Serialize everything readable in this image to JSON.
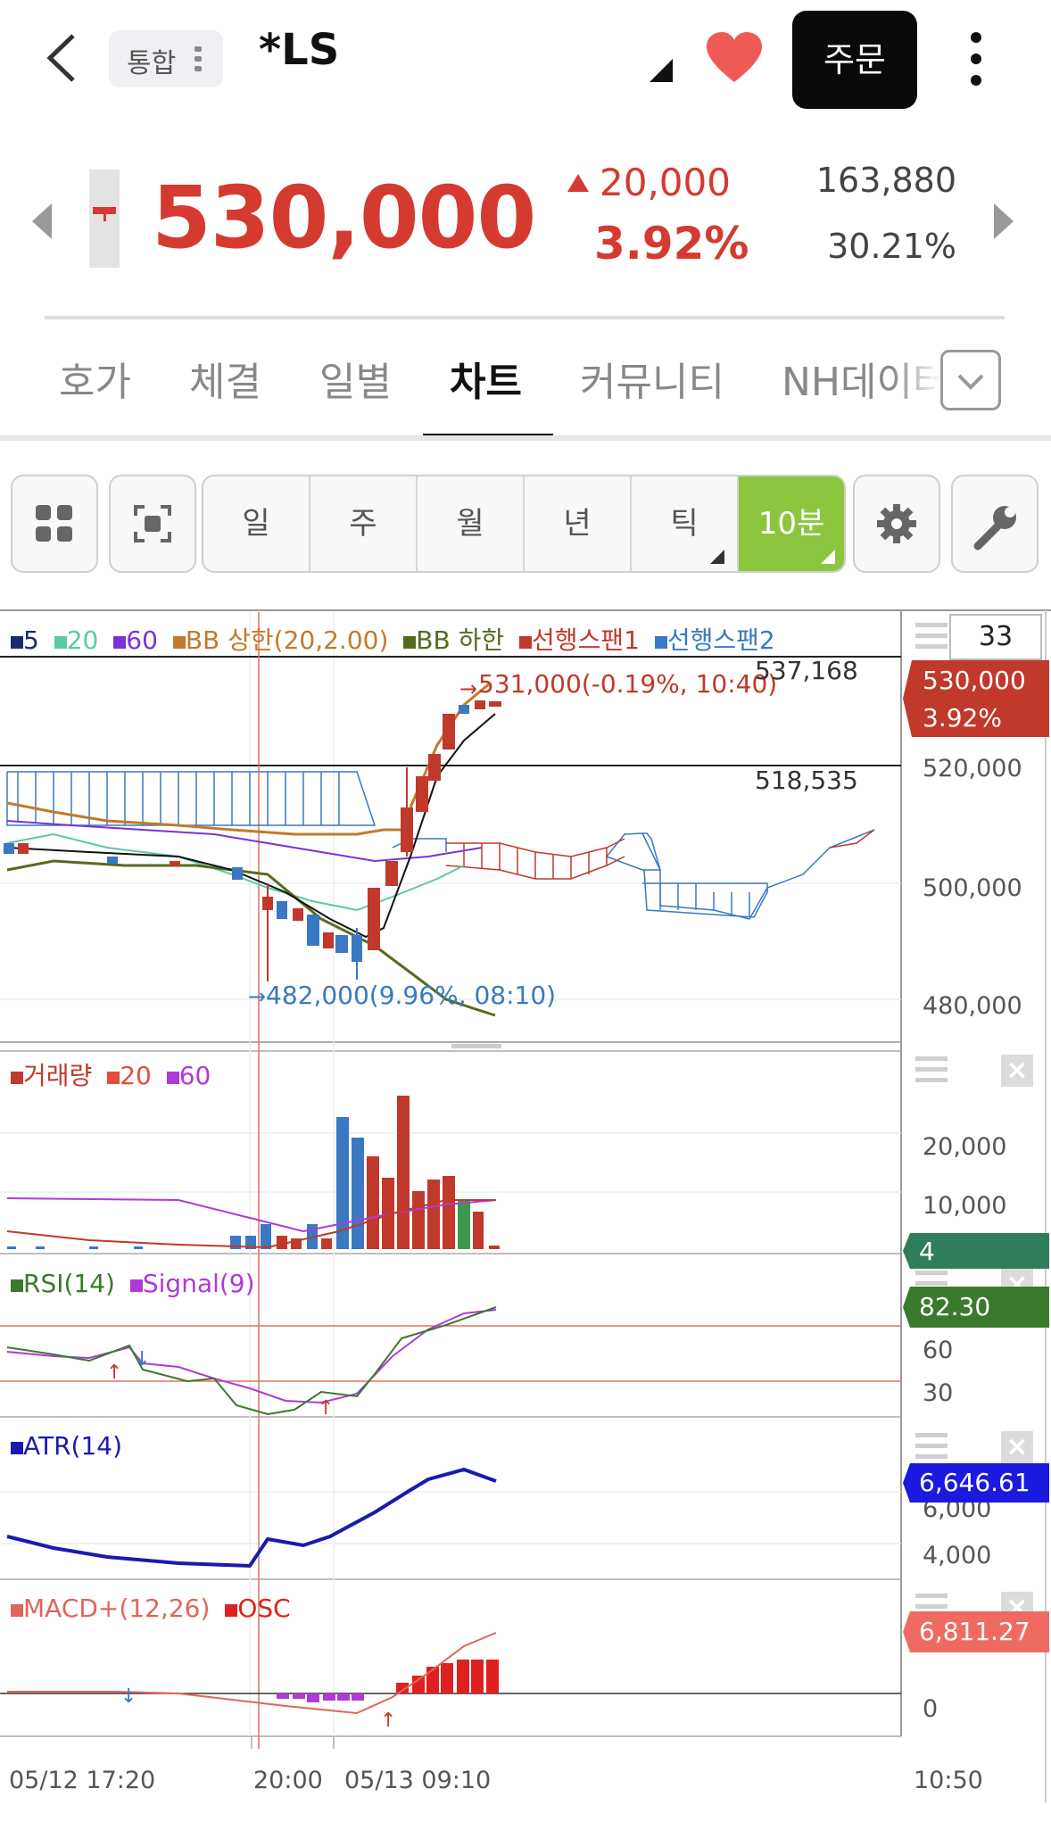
{
  "header": {
    "back": "back",
    "market_tag": "통합",
    "stock_name": "*LS",
    "order_button": "주문"
  },
  "quote": {
    "price": "530,000",
    "change": "20,000",
    "change_pct": "3.92%",
    "volume": "163,880",
    "volume_pct": "30.21%",
    "color_up": "#d43a2f"
  },
  "tabs": [
    "호가",
    "체결",
    "일별",
    "차트",
    "커뮤니티",
    "NH데이터"
  ],
  "active_tab": "차트",
  "toolbar": {
    "periods": [
      "일",
      "주",
      "월",
      "년",
      "틱",
      "10분"
    ],
    "active_period": "10분",
    "accent": "#8cc63f"
  },
  "main_chart": {
    "legend": [
      {
        "label": "5",
        "color": "#1a2a6c"
      },
      {
        "label": "20",
        "color": "#5cc8a8"
      },
      {
        "label": "60",
        "color": "#7a33d6"
      },
      {
        "label": "BB 상한(20,2.00)",
        "color": "#c27a2c"
      },
      {
        "label": "BB 하한",
        "color": "#556b1f"
      },
      {
        "label": "선행스팬1",
        "color": "#c0392b"
      },
      {
        "label": "선행스팬2",
        "color": "#3a78c3"
      }
    ],
    "count": "33",
    "high_note": "531,000(-0.19%, 10:40)",
    "low_note": "482,000(9.96%, 08:10)",
    "line_label_top": "537,168",
    "line_label_mid": "518,535",
    "current_price_badge": "530,000",
    "current_pct_badge": "3.92%",
    "y_ticks": [
      "520,000",
      "500,000",
      "480,000"
    ]
  },
  "volume_chart": {
    "legend": [
      {
        "label": "거래량",
        "color": "#c0392b"
      },
      {
        "label": "20",
        "color": "#e74c3c"
      },
      {
        "label": "60",
        "color": "#b03ad6"
      }
    ],
    "badge": "4",
    "y_ticks": [
      "20,000",
      "10,000"
    ]
  },
  "rsi_chart": {
    "legend": [
      {
        "label": "RSI(14)",
        "color": "#3a7a2c"
      },
      {
        "label": "Signal(9)",
        "color": "#b03ad6"
      }
    ],
    "badge": "82.30",
    "y_ticks": [
      "60",
      "30"
    ]
  },
  "atr_chart": {
    "legend": [
      {
        "label": "ATR(14)",
        "color": "#1a1ab0"
      }
    ],
    "badge": "6,646.61",
    "y_ticks": [
      "6,000",
      "4,000"
    ]
  },
  "macd_chart": {
    "legend": [
      {
        "label": "MACD+(12,26)",
        "color": "#e0655a"
      },
      {
        "label": "OSC",
        "color": "#e02020"
      }
    ],
    "badge": "6,811.27",
    "y_ticks": [
      "0"
    ]
  },
  "x_axis": [
    "05/12 17:20",
    "20:00",
    "05/13 09:10",
    "10:50"
  ]
}
